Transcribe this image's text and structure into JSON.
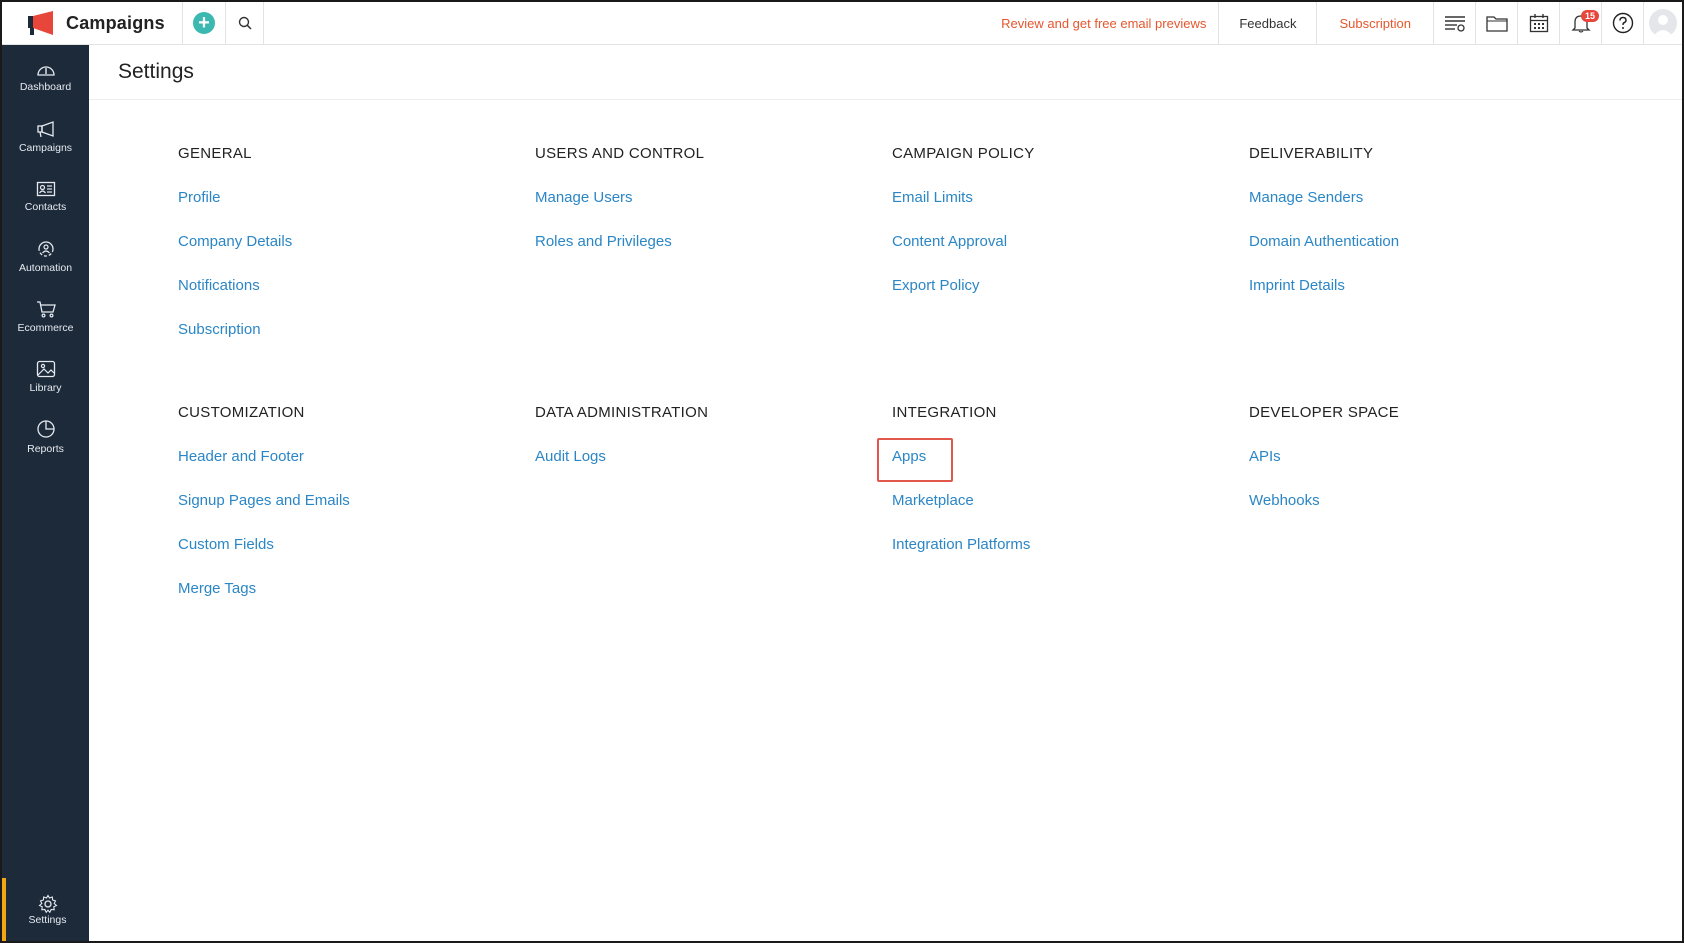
{
  "app": {
    "name": "Campaigns",
    "add_icon": "plus-circle-icon",
    "search_icon": "search-icon"
  },
  "topbar": {
    "review_link": "Review and get free email previews",
    "feedback_link": "Feedback",
    "subscription_link": "Subscription",
    "notification_count": "15",
    "icons": [
      "list-filter-icon",
      "folder-icon",
      "calendar-icon",
      "bell-icon",
      "help-icon",
      "avatar"
    ]
  },
  "sidebar": {
    "items": [
      {
        "label": "Dashboard",
        "icon": "dashboard-icon"
      },
      {
        "label": "Campaigns",
        "icon": "megaphone-icon"
      },
      {
        "label": "Contacts",
        "icon": "contact-card-icon"
      },
      {
        "label": "Automation",
        "icon": "automation-icon"
      },
      {
        "label": "Ecommerce",
        "icon": "cart-icon"
      },
      {
        "label": "Library",
        "icon": "image-library-icon"
      },
      {
        "label": "Reports",
        "icon": "pie-chart-icon"
      }
    ],
    "settings": {
      "label": "Settings",
      "icon": "gear-icon",
      "active": true
    }
  },
  "page": {
    "title": "Settings"
  },
  "sections": {
    "general": {
      "title": "GENERAL",
      "links": [
        "Profile",
        "Company Details",
        "Notifications",
        "Subscription"
      ]
    },
    "users_control": {
      "title": "USERS AND CONTROL",
      "links": [
        "Manage Users",
        "Roles and Privileges"
      ]
    },
    "campaign_policy": {
      "title": "CAMPAIGN POLICY",
      "links": [
        "Email Limits",
        "Content Approval",
        "Export Policy"
      ]
    },
    "deliverability": {
      "title": "DELIVERABILITY",
      "links": [
        "Manage Senders",
        "Domain Authentication",
        "Imprint Details"
      ]
    },
    "customization": {
      "title": "CUSTOMIZATION",
      "links": [
        "Header and Footer",
        "Signup Pages and Emails",
        "Custom Fields",
        "Merge Tags"
      ]
    },
    "data_admin": {
      "title": "DATA ADMINISTRATION",
      "links": [
        "Audit Logs"
      ]
    },
    "integration": {
      "title": "INTEGRATION",
      "links": [
        "Apps",
        "Marketplace",
        "Integration Platforms"
      ],
      "highlighted": "Apps"
    },
    "developer_space": {
      "title": "DEVELOPER SPACE",
      "links": [
        "APIs",
        "Webhooks"
      ]
    }
  },
  "colors": {
    "sidebar_bg": "#1d2a3a",
    "link": "#2b86c6",
    "accent_orange": "#e4572e",
    "active_marker": "#f3a712",
    "highlight_box": "#e2574c",
    "add_button": "#3bb8b0"
  }
}
